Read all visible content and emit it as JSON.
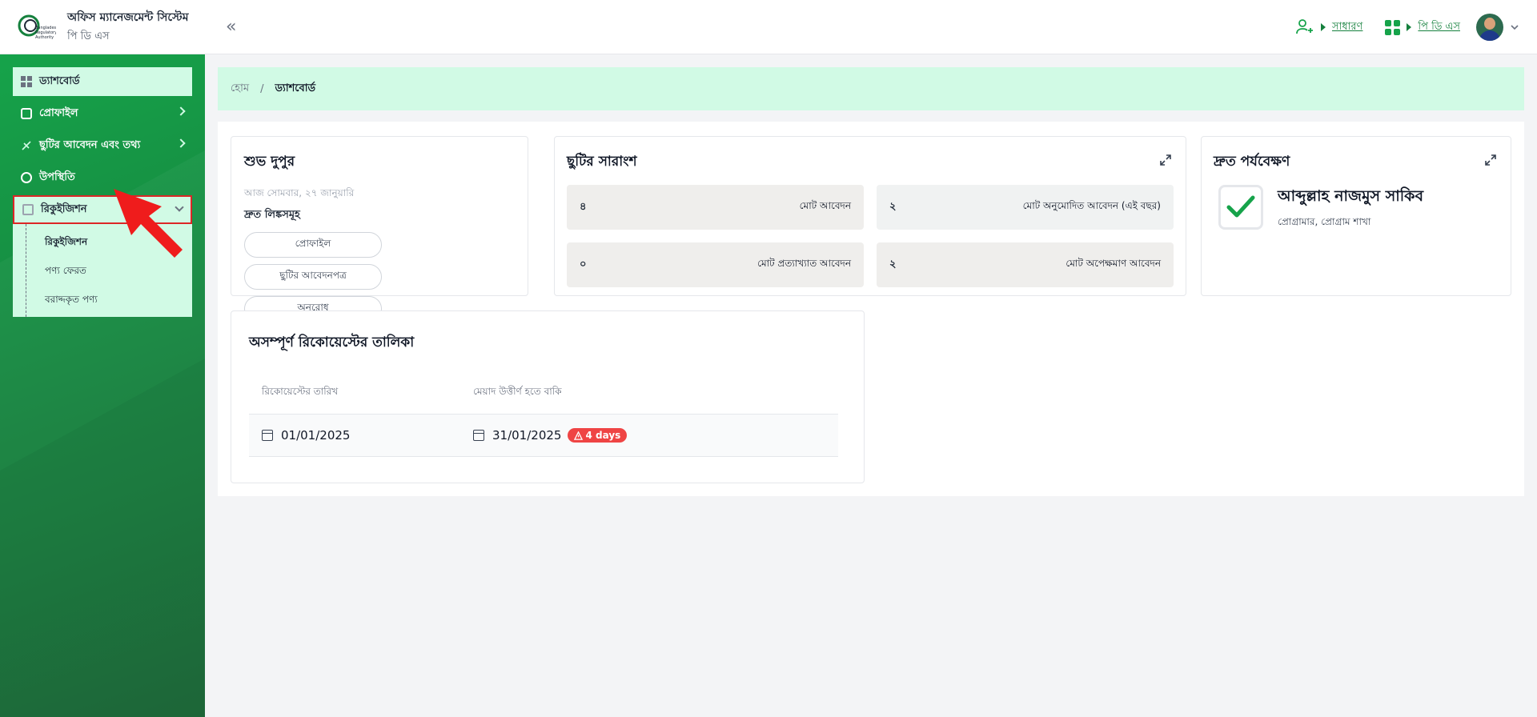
{
  "app": {
    "title": "অফিস ম্যানেজমেন্ট সিস্টেম",
    "subtitle": "পি ডি এস",
    "logo_text": "Bangladesh Regulatory Authority"
  },
  "header": {
    "role_label": "সাধারণ",
    "module_label": "পি ডি এস",
    "icons": {
      "role": "user-switch-icon",
      "module": "apps-grid-icon",
      "collapse": "double-chevron-left-icon",
      "avatar_caret": "chevron-down-icon"
    }
  },
  "sidebar": {
    "items": [
      {
        "label": "ড্যাশবোর্ড",
        "icon": "dashboard-icon"
      },
      {
        "label": "প্রোফাইল",
        "icon": "profile-icon"
      },
      {
        "label": "ছুটির আবেদন এবং তথ্য",
        "icon": "leave-icon"
      },
      {
        "label": "উপস্থিতি",
        "icon": "clock-icon"
      },
      {
        "label": "রিকুইজিশন",
        "icon": "requisition-icon"
      }
    ],
    "requisition_sub": [
      {
        "label": "রিকুইজিশন"
      },
      {
        "label": "পণ্য ফেরত"
      },
      {
        "label": "বরাদ্দকৃত পণ্য"
      }
    ]
  },
  "breadcrumb": {
    "home": "হোম",
    "separator": "/",
    "current": "ড্যাশবোর্ড"
  },
  "greeting": {
    "title": "শুভ দুপুর",
    "date": "আজ সোমবার, ২৭ জানুয়ারি",
    "quick_links_label": "দ্রুত লিঙ্কসমূহ",
    "links": [
      "প্রোফাইল",
      "ছুটির আবেদনপত্র",
      "অনুরোধ"
    ]
  },
  "leave_summary": {
    "title": "ছুটির সারাংশ",
    "stats": [
      {
        "label": "মোট আবেদন",
        "value": "৪"
      },
      {
        "label": "মোট অনুমোদিত আবেদন (এই বছর)",
        "value": "২"
      },
      {
        "label": "মোট প্রত্যাখ্যাত আবেদন",
        "value": "০"
      },
      {
        "label": "মোট অপেক্ষমাণ আবেদন",
        "value": "২"
      }
    ]
  },
  "monitoring": {
    "title": "দ্রুত পর্যবেক্ষণ",
    "name": "আব্দুল্লাহ নাজমুস সাকিব",
    "role": "প্রোগ্রামার, প্রোগ্রাম শাখা"
  },
  "pending_requests": {
    "title": "অসম্পূর্ণ রিকোয়েস্টের তালিকা",
    "columns": [
      "রিকোয়েস্টের তারিখ",
      "মেয়াদ উত্তীর্ণ হতে বাকি"
    ],
    "rows": [
      {
        "request_date": "01/01/2025",
        "expiry_date": "31/01/2025",
        "remaining": "4 days"
      }
    ]
  },
  "colors": {
    "primary": "#16a34a",
    "light_green": "#d1fae5",
    "danger": "#ef4444",
    "highlight_border": "#dc2626"
  }
}
